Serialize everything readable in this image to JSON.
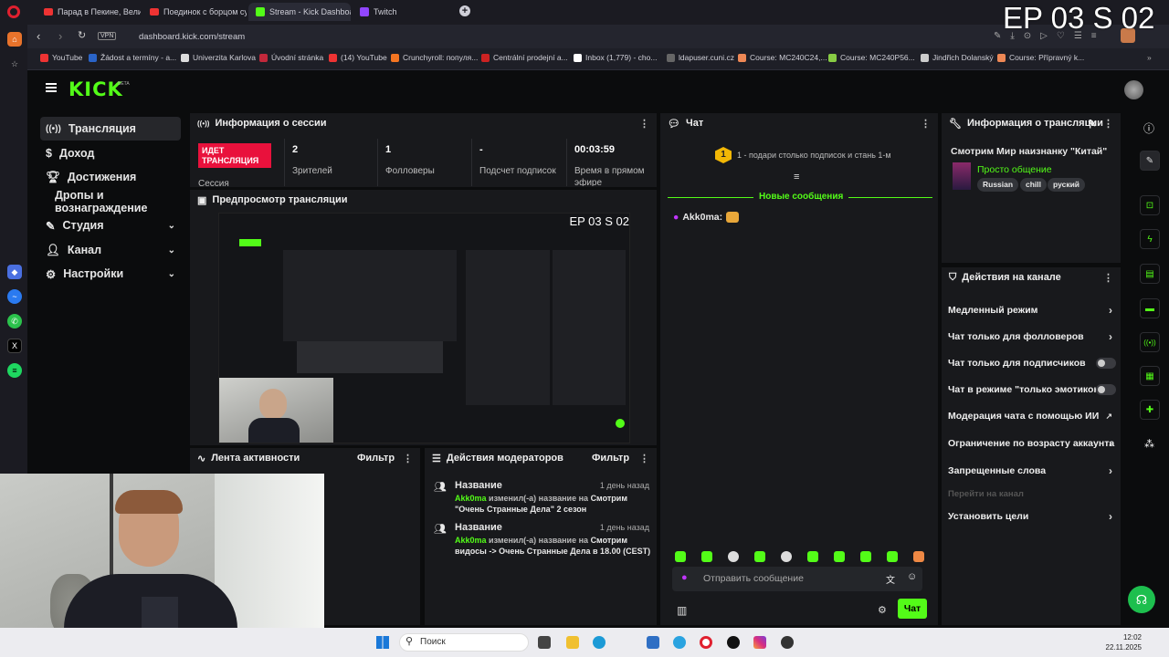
{
  "overlay_title": "EP 03 S 02",
  "tabs": [
    {
      "label": "Парад в Пекине, Великая"
    },
    {
      "label": "Поединок с борцом сумо"
    },
    {
      "label": "Stream - Kick Dashboard"
    },
    {
      "label": "Twitch"
    }
  ],
  "address": {
    "url": "dashboard.kick.com/stream",
    "vpn": "VPN"
  },
  "bookmarks": [
    "YouTube",
    "Žádost a termíny - a...",
    "Univerzita Karlova",
    "Úvodní stránka",
    "(14) YouTube",
    "Crunchyroll: популя...",
    "Centrální prodejní a...",
    "Inbox (1,779) - cho...",
    "ldapuser.cuni.cz",
    "Course: MC240C24,...",
    "Course: MC240P56...",
    "Jindřich Dolanský",
    "Course: Přípravný k..."
  ],
  "brand": {
    "logo": "KICK",
    "beta": "BETA"
  },
  "nav": [
    {
      "label": "Трансляция"
    },
    {
      "label": "Доход"
    },
    {
      "label": "Достижения"
    },
    {
      "label": "Дропы и вознаграждение"
    },
    {
      "label": "Студия"
    },
    {
      "label": "Канал"
    },
    {
      "label": "Настройки"
    }
  ],
  "session": {
    "title": "Информация о сессии",
    "live_badge": "ИДЕТ ТРАНСЛЯЦИЯ",
    "session_label": "Сессия",
    "stats": [
      {
        "value": "2",
        "label": "Зрителей"
      },
      {
        "value": "1",
        "label": "Фолловеры"
      },
      {
        "value": "-",
        "label": "Подсчет подписок"
      },
      {
        "value": "00:03:59",
        "label": "Время в прямом эфире"
      }
    ]
  },
  "preview": {
    "title": "Предпросмотр трансляции",
    "overlay": "EP 03 S 02"
  },
  "activity": {
    "title": "Лента активности",
    "filter": "Фильтр"
  },
  "modactions": {
    "title": "Действия модераторов",
    "filter": "Фильтр",
    "items": [
      {
        "title": "Название",
        "time": "1 день назад",
        "user": "Akk0ma",
        "verb": "изменил(-а) название на",
        "text": "Смотрим \"Очень Странные Дела\" 2 сезон"
      },
      {
        "title": "Название",
        "time": "1 день назад",
        "user": "Akk0ma",
        "verb": "изменил(-а) название на",
        "text": "Смотрим видосы -> Очень Странные Дела в 18.00 (CEST)"
      }
    ]
  },
  "chat": {
    "title": "Чат",
    "gift_badge": "1",
    "gift_text": "1 - подари столько подписок и стань 1-м",
    "new_messages": "Новые сообщения",
    "message_user": "Akk0ma:",
    "input_placeholder": "Отправить сообщение",
    "send_label": "Чат"
  },
  "stream_info": {
    "title": "Информация о трансляции",
    "stream_title": "Смотрим Мир наизнанку \"Китай\"",
    "category": "Просто общение",
    "tags": [
      "Russian",
      "chill",
      "руский"
    ]
  },
  "channel_actions": {
    "title": "Действия на канале",
    "items": [
      {
        "label": "Медленный режим",
        "kind": "arrow"
      },
      {
        "label": "Чат только для фолловеров",
        "kind": "arrow"
      },
      {
        "label": "Чат только для подписчиков",
        "kind": "toggle"
      },
      {
        "label": "Чат в режиме \"только эмотиконы\"",
        "kind": "toggle"
      },
      {
        "label": "Модерация чата с помощью ИИ",
        "kind": "external"
      },
      {
        "label": "Ограничение по возрасту аккаунта",
        "kind": "arrow"
      },
      {
        "label": "Запрещенные слова",
        "kind": "arrow"
      },
      {
        "label": "Перейти на канал",
        "kind": "disabled"
      },
      {
        "label": "Установить цели",
        "kind": "arrow"
      }
    ]
  },
  "taskbar": {
    "search": "Поиск",
    "time": "12:02",
    "date": "22.11.2025"
  },
  "colors": {
    "accent": "#53fc18",
    "live": "#e9113c",
    "panel": "#18191c"
  }
}
